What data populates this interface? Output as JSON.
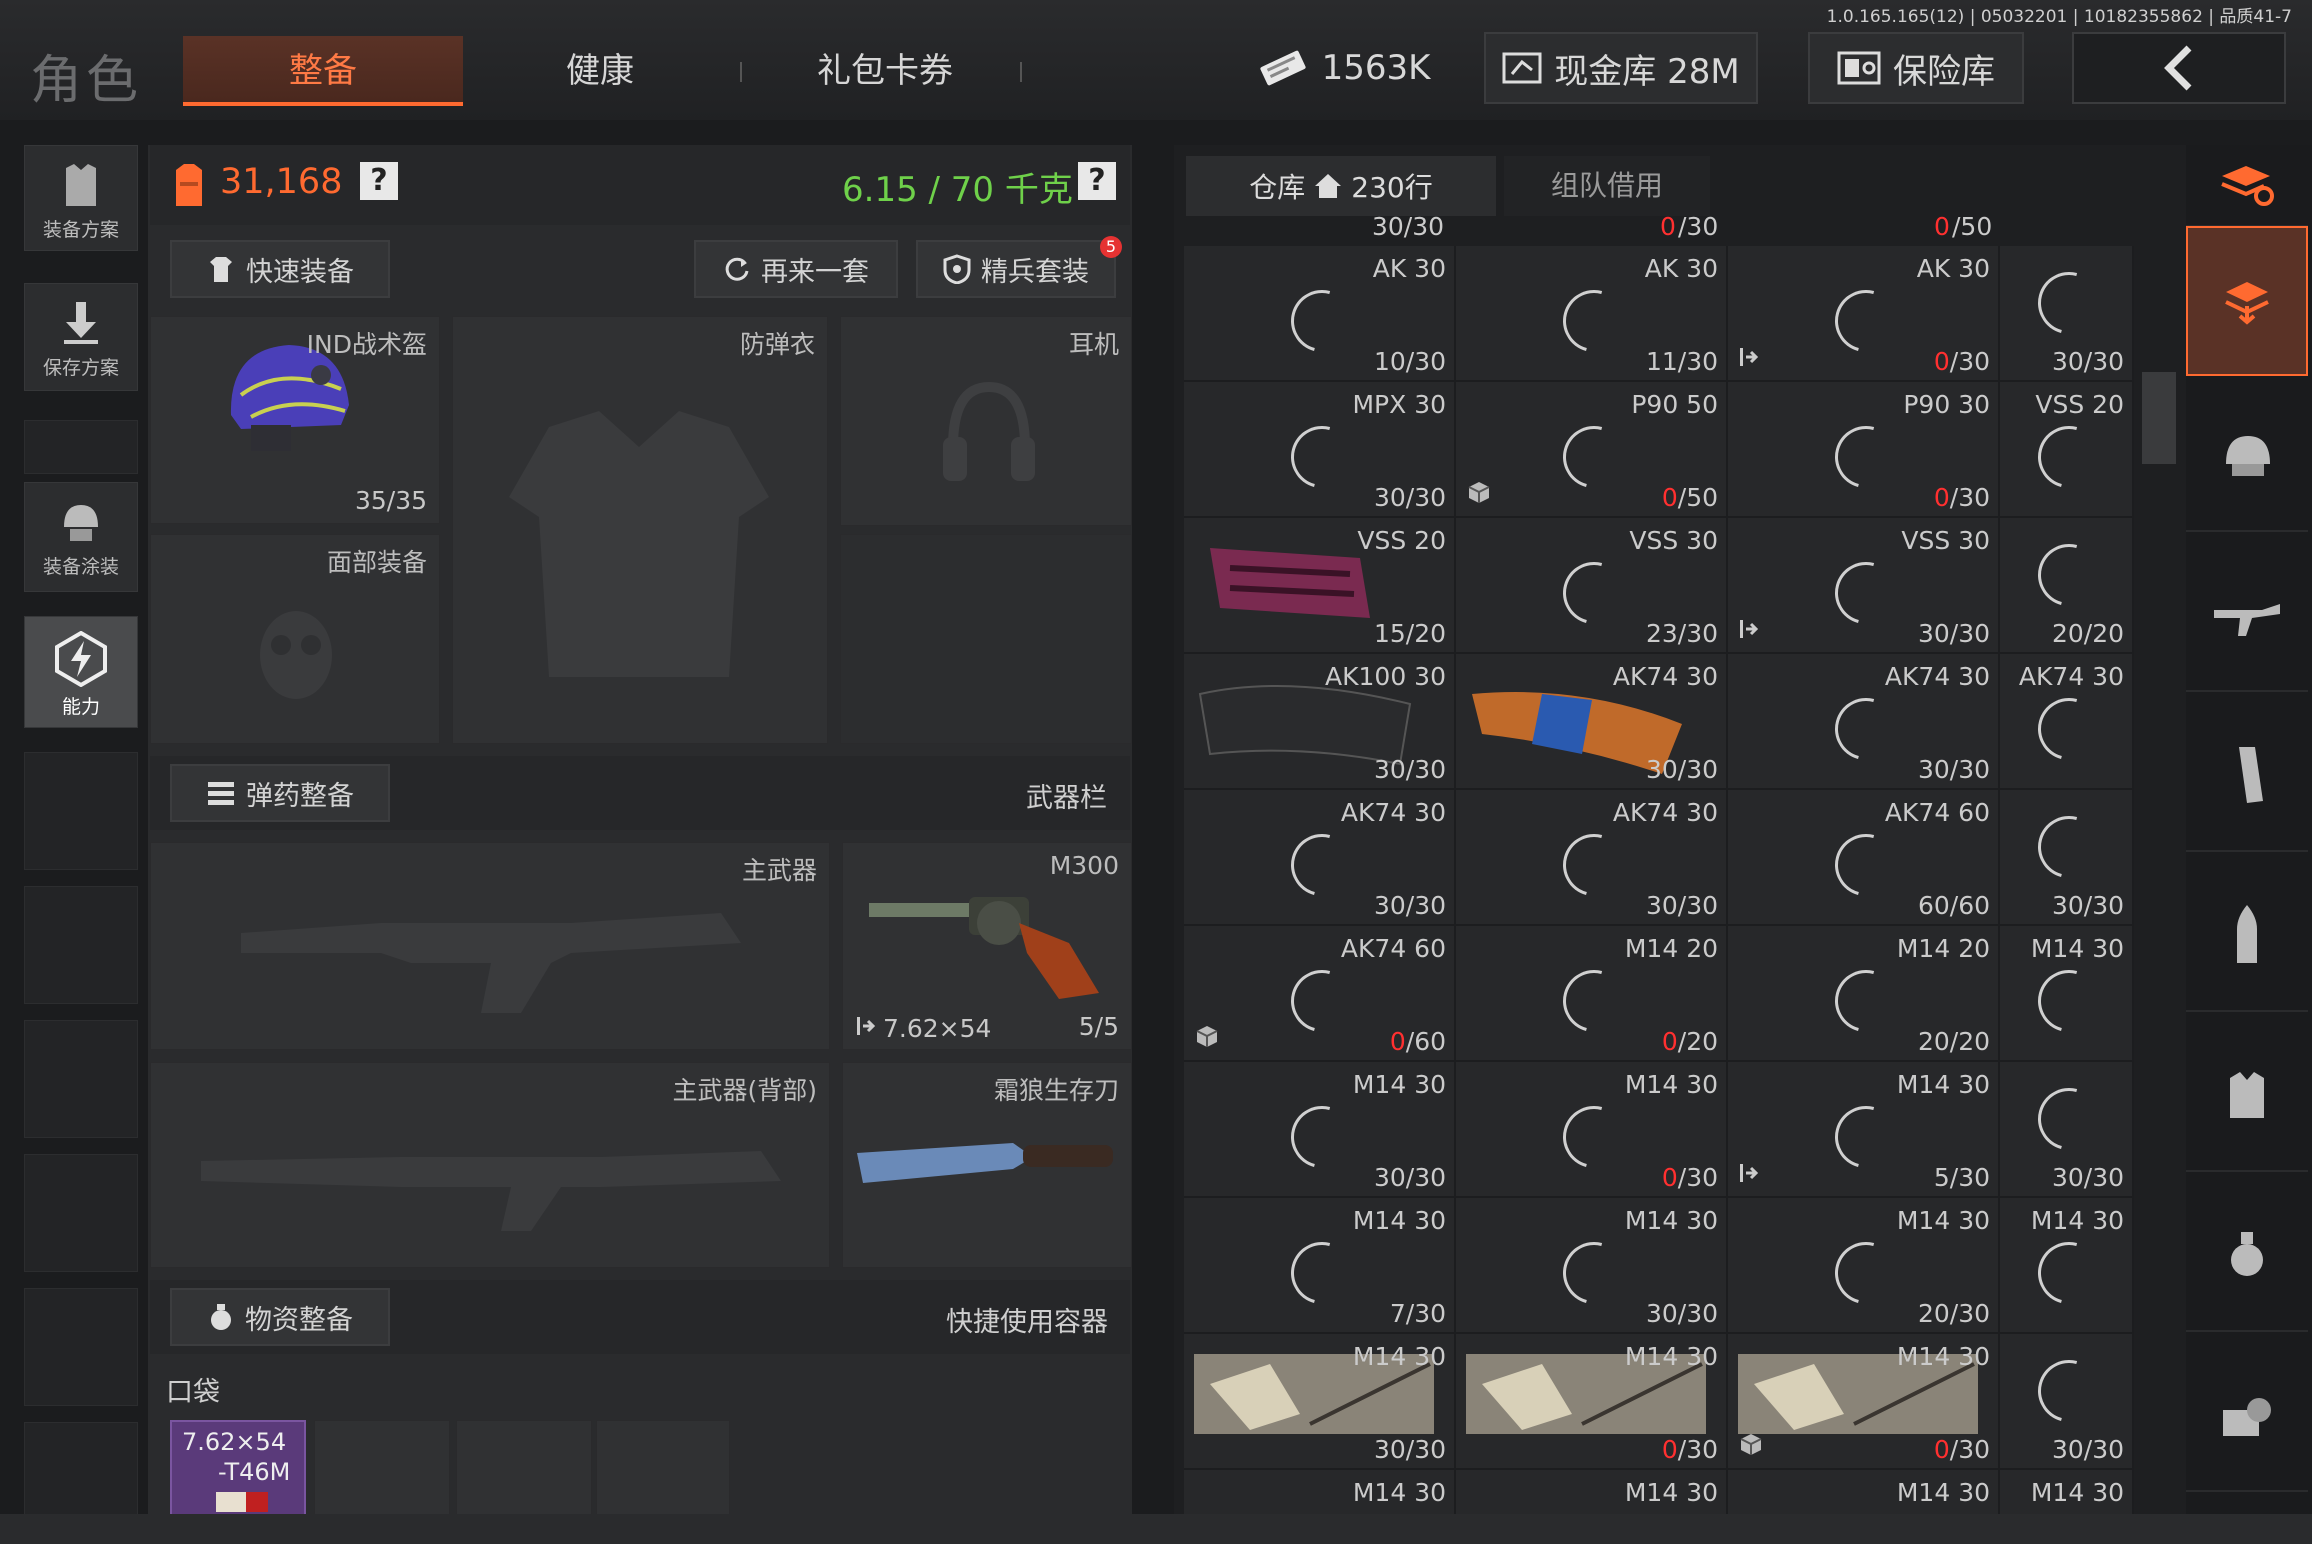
{
  "version": "1.0.165.165(12) | 05032201 | 10182355862 | 品质41-7",
  "header": {
    "title": "角色",
    "tabs": [
      "整备",
      "健康",
      "礼包卡券"
    ],
    "coupons": "1563K",
    "cash": "现金库 28M",
    "safe": "保险库"
  },
  "rail": {
    "loadout": "装备方案",
    "save": "保存方案",
    "paint": "装备涂装",
    "ability": "能力"
  },
  "equip": {
    "value": "31,168",
    "weight": "6.15 / 70 千克",
    "help": "?",
    "quick": "快速装备",
    "again": "再来一套",
    "elite": "精兵套装",
    "elite_badge": "5",
    "helmet_name": "IND战术盔",
    "helmet_dur": "35/35",
    "armor": "防弹衣",
    "headset": "耳机",
    "face": "面部装备",
    "ammo_btn": "弹药整备",
    "weapon_bar": "武器栏",
    "primary": "主武器",
    "pistol_name": "M300",
    "pistol_ammo": "7.62×54",
    "pistol_count": "5/5",
    "primary_back": "主武器(背部)",
    "knife": "霜狼生存刀",
    "supply_btn": "物资整备",
    "quick_container": "快捷使用容器",
    "pocket": "口袋",
    "pocket_item_line1": "7.62×54",
    "pocket_item_line2": "-T46M"
  },
  "warehouse": {
    "tab_warehouse": "仓库",
    "rows": "230行",
    "tab_team": "组队借用",
    "top_partial": [
      {
        "pre": "30/30",
        "zero": ""
      },
      {
        "pre": "",
        "zero": "0",
        "post": "/30"
      },
      {
        "pre": "",
        "zero": "0",
        "post": "/50"
      }
    ],
    "cells": [
      {
        "name": "AK 30",
        "count": "10/30"
      },
      {
        "name": "AK 30",
        "count": "11/30"
      },
      {
        "name": "AK 30",
        "zero": "0",
        "count": "/30",
        "flag": "exit"
      },
      {
        "name": "",
        "count": "30/30"
      },
      {
        "name": "MPX 30",
        "count": "30/30"
      },
      {
        "name": "P90 50",
        "zero": "0",
        "count": "/50",
        "flag": "box"
      },
      {
        "name": "P90 30",
        "zero": "0",
        "count": "/30"
      },
      {
        "name": "VSS 20",
        "count": ""
      },
      {
        "name": "VSS 20",
        "count": "15/20",
        "img": "vss"
      },
      {
        "name": "VSS 30",
        "count": "23/30"
      },
      {
        "name": "VSS 30",
        "count": "30/30",
        "flag": "exit"
      },
      {
        "name": "",
        "count": "20/20"
      },
      {
        "name": "AK100 30",
        "count": "30/30",
        "img": "ak100"
      },
      {
        "name": "AK74 30",
        "count": "30/30",
        "img": "ak74"
      },
      {
        "name": "AK74 30",
        "count": "30/30"
      },
      {
        "name": "AK74 30",
        "count": ""
      },
      {
        "name": "AK74 30",
        "count": "30/30"
      },
      {
        "name": "AK74 30",
        "count": "30/30"
      },
      {
        "name": "AK74 60",
        "count": "60/60"
      },
      {
        "name": "",
        "count": "30/30"
      },
      {
        "name": "AK74 60",
        "zero": "0",
        "count": "/60",
        "flag": "box"
      },
      {
        "name": "M14 20",
        "zero": "0",
        "count": "/20"
      },
      {
        "name": "M14 20",
        "count": "20/20"
      },
      {
        "name": "M14 30",
        "count": ""
      },
      {
        "name": "M14 30",
        "count": "30/30"
      },
      {
        "name": "M14 30",
        "zero": "0",
        "count": "/30"
      },
      {
        "name": "M14 30",
        "count": "5/30",
        "flag": "exit"
      },
      {
        "name": "",
        "count": "30/30"
      },
      {
        "name": "M14 30",
        "count": "7/30"
      },
      {
        "name": "M14 30",
        "count": "30/30"
      },
      {
        "name": "M14 30",
        "count": "20/30"
      },
      {
        "name": "M14 30",
        "count": ""
      },
      {
        "name": "M14 30",
        "count": "30/30",
        "img": "m14"
      },
      {
        "name": "M14 30",
        "zero": "0",
        "count": "/30",
        "img": "m14"
      },
      {
        "name": "M14 30",
        "zero": "0",
        "count": "/30",
        "img": "m14",
        "flag": "box"
      },
      {
        "name": "",
        "count": "30/30"
      },
      {
        "name": "M14 30",
        "count": ""
      },
      {
        "name": "M14 30",
        "count": ""
      },
      {
        "name": "M14 30",
        "count": ""
      },
      {
        "name": "M14 30",
        "count": ""
      }
    ]
  },
  "colors": {
    "accent": "#ff6a30",
    "green": "#6fd14a",
    "red": "#ff3030"
  }
}
